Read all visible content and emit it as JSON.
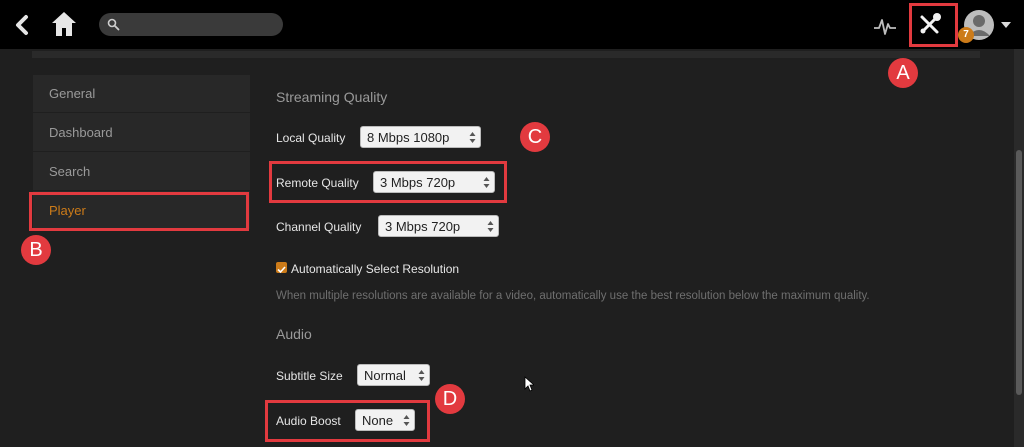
{
  "topbar": {
    "search": {
      "value": "",
      "placeholder": ""
    },
    "notification_count": "7"
  },
  "sidebar": {
    "items": [
      {
        "label": "General",
        "active": false
      },
      {
        "label": "Dashboard",
        "active": false
      },
      {
        "label": "Search",
        "active": false
      },
      {
        "label": "Player",
        "active": true
      }
    ]
  },
  "content": {
    "streaming_section": "Streaming Quality",
    "local_quality": {
      "label": "Local Quality",
      "value": "8 Mbps 1080p"
    },
    "remote_quality": {
      "label": "Remote Quality",
      "value": "3 Mbps 720p"
    },
    "channel_quality": {
      "label": "Channel Quality",
      "value": "3 Mbps 720p"
    },
    "auto_resolution": {
      "label": "Automatically Select Resolution",
      "checked": true
    },
    "help_text": "When multiple resolutions are available for a video, automatically use the best resolution below the maximum quality.",
    "audio_section": "Audio",
    "subtitle_size": {
      "label": "Subtitle Size",
      "value": "Normal"
    },
    "audio_boost": {
      "label": "Audio Boost",
      "value": "None"
    }
  },
  "annotations": {
    "a": "A",
    "b": "B",
    "c": "C",
    "d": "D",
    "color": "#e23a3f"
  },
  "colors": {
    "accent": "#cc7b19",
    "background": "#1f1f1f",
    "topbar": "#000000"
  },
  "icons": [
    "back-icon",
    "home-icon",
    "search-icon",
    "activity-icon",
    "tools-icon",
    "user-avatar-icon",
    "caret-down-icon",
    "select-arrows-icon",
    "checkbox-check-icon"
  ]
}
